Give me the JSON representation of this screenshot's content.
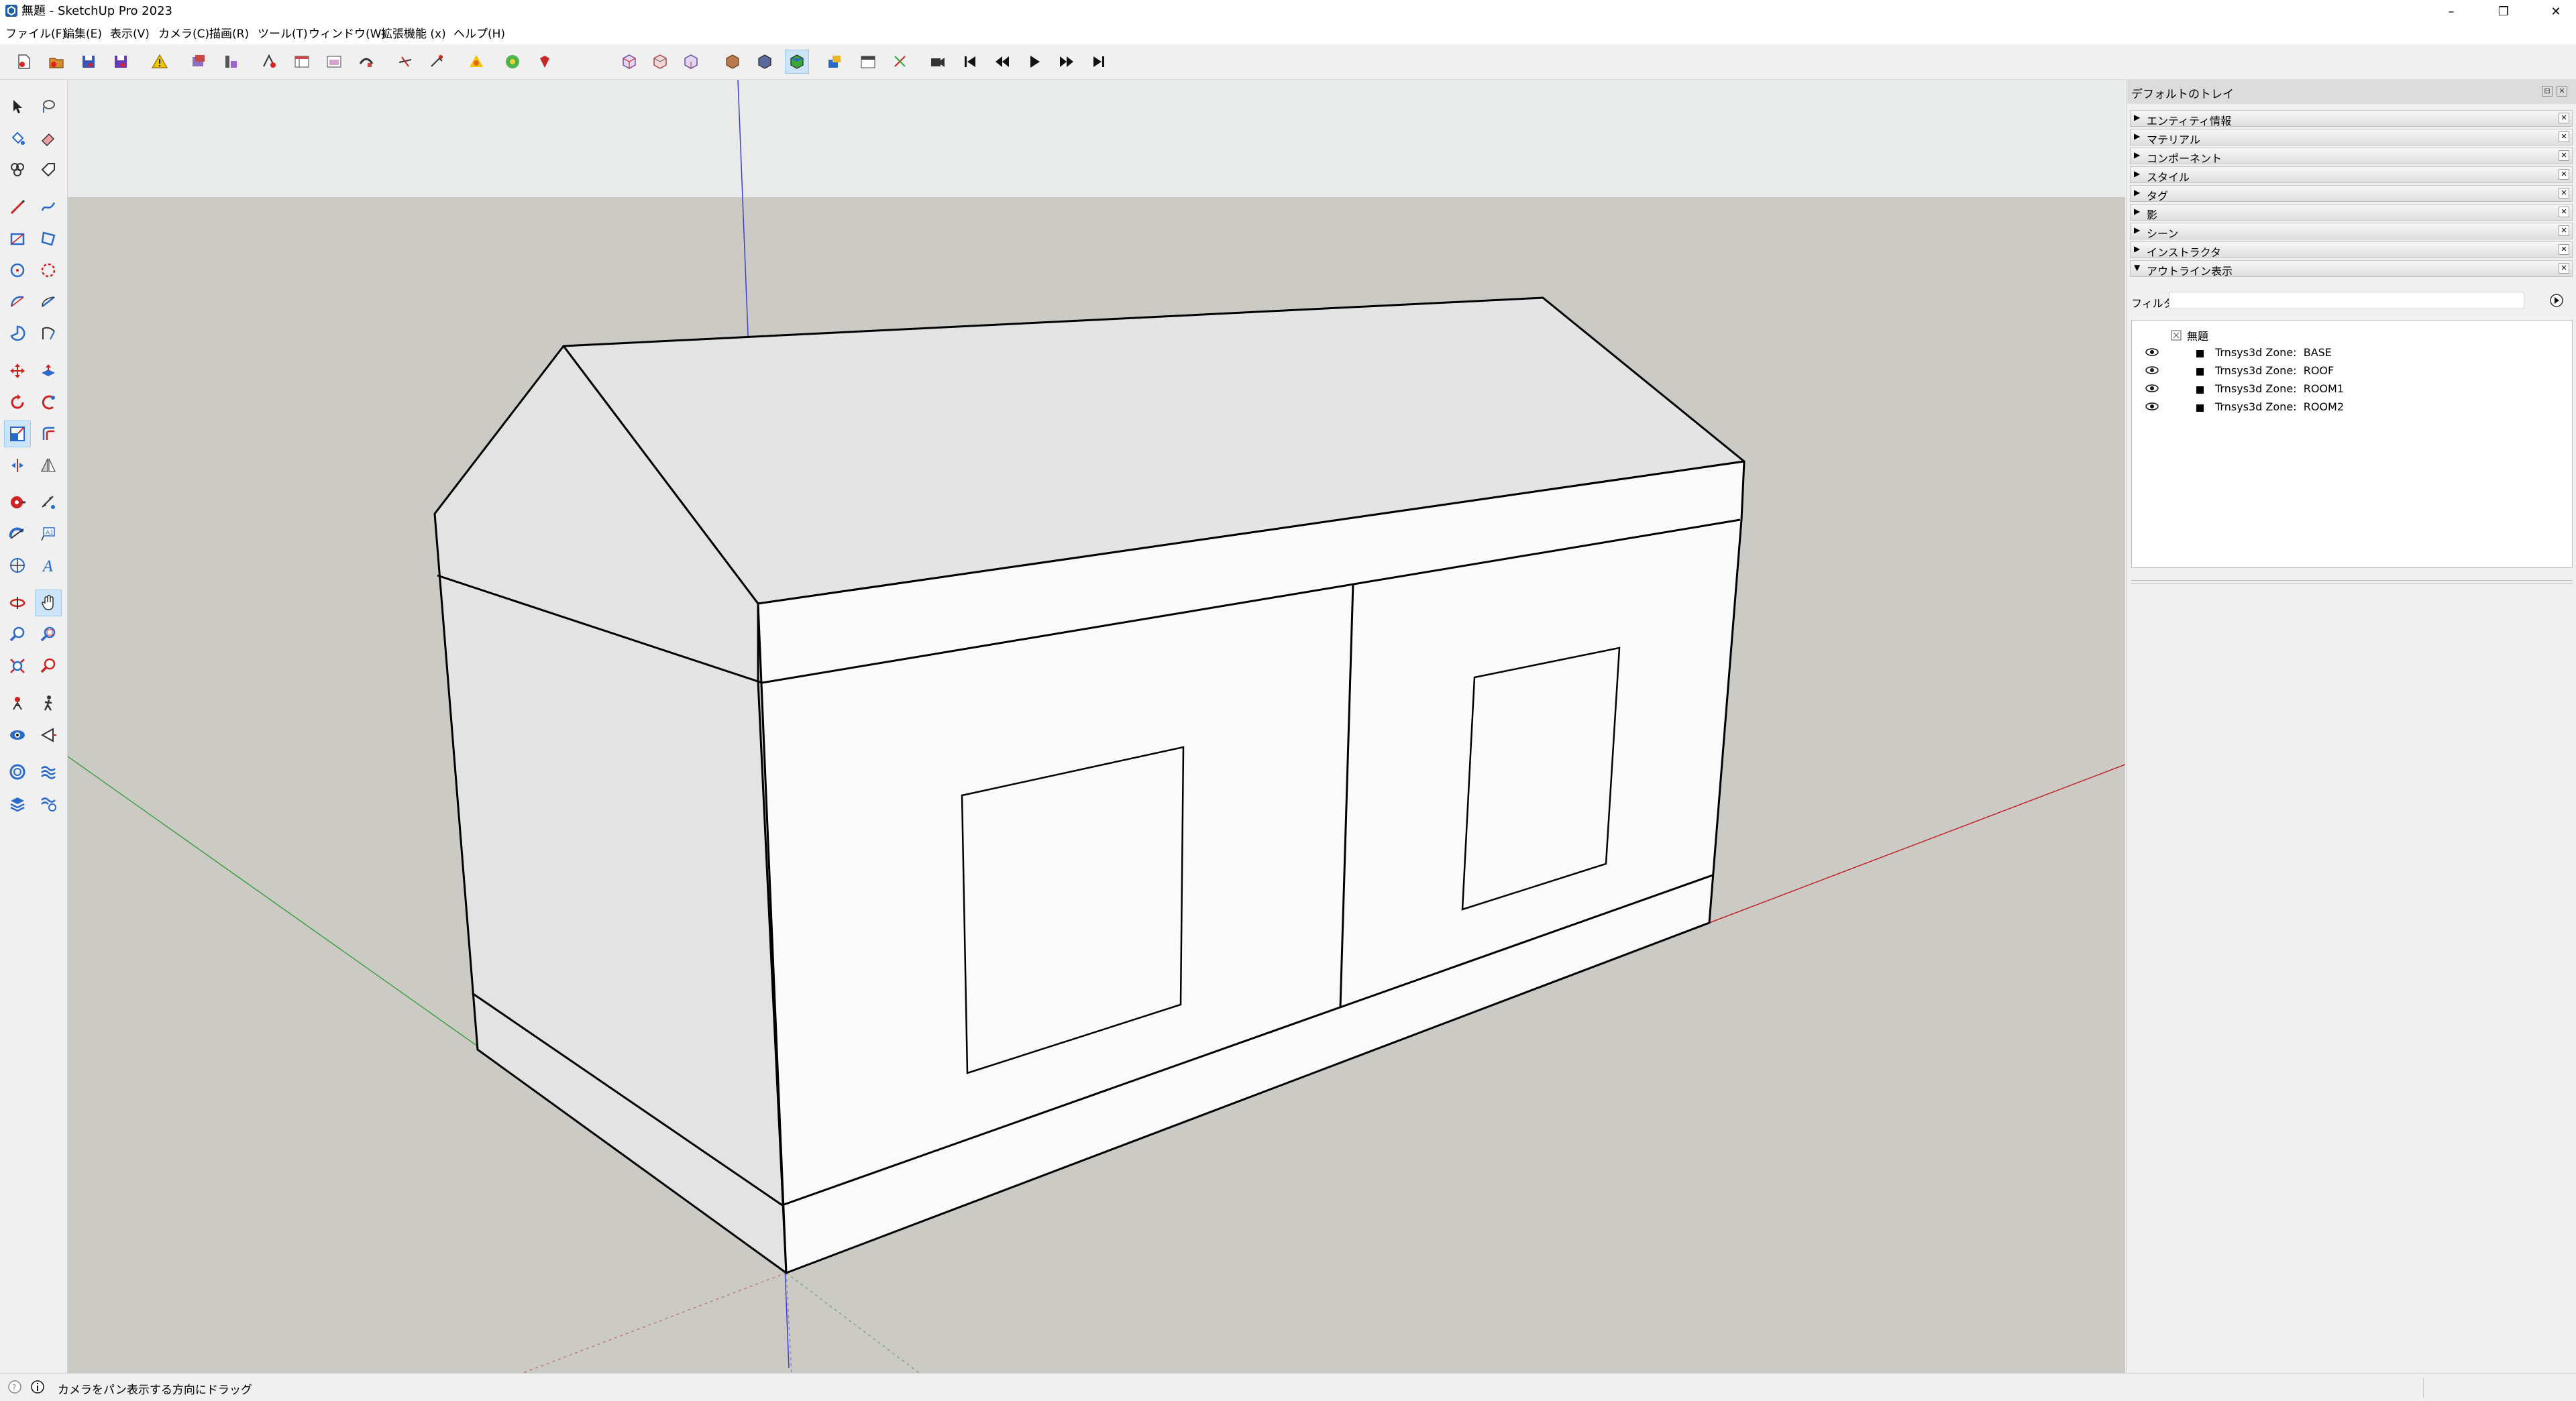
{
  "window": {
    "title": "無題 - SketchUp Pro 2023",
    "minimize": "–",
    "restore": "❐",
    "close": "✕"
  },
  "menu": [
    "ファイル(F)",
    "編集(E)",
    "表示(V)",
    "カメラ(C)",
    "描画(R)",
    "ツール(T)",
    "ウィンドウ(W)",
    "拡張機能 (x)",
    "ヘルプ(H)"
  ],
  "tray": {
    "title": "デフォルトのトレイ",
    "panels": [
      {
        "label": "エンティティ情報",
        "arrow": "▶"
      },
      {
        "label": "マテリアル",
        "arrow": "▶"
      },
      {
        "label": "コンポーネント",
        "arrow": "▶"
      },
      {
        "label": "スタイル",
        "arrow": "▶"
      },
      {
        "label": "タグ",
        "arrow": "▶"
      },
      {
        "label": "影",
        "arrow": "▶"
      },
      {
        "label": "シーン",
        "arrow": "▶"
      },
      {
        "label": "インストラクタ",
        "arrow": "▶"
      },
      {
        "label": "アウトライン表示",
        "arrow": "▼"
      }
    ],
    "filter_label": "フィルタ:",
    "filter_value": "",
    "outliner": {
      "root": "無題",
      "items": [
        "Trnsys3d Zone:  BASE",
        "Trnsys3d Zone:  ROOF",
        "Trnsys3d Zone:  ROOM1",
        "Trnsys3d Zone:  ROOM2"
      ]
    }
  },
  "status": {
    "text": "カメラをパン表示する方向にドラッグ"
  },
  "colors": {
    "sky": "#e9ebea",
    "ground": "#cbcac5",
    "face_light": "#fafafa",
    "face_dark": "#e3e3e3",
    "roof": "#e4e4e4",
    "axis_red": "#c0282d",
    "axis_green": "#3ea03e",
    "axis_blue": "#4040c8",
    "tool_active": "#cce4f7"
  }
}
